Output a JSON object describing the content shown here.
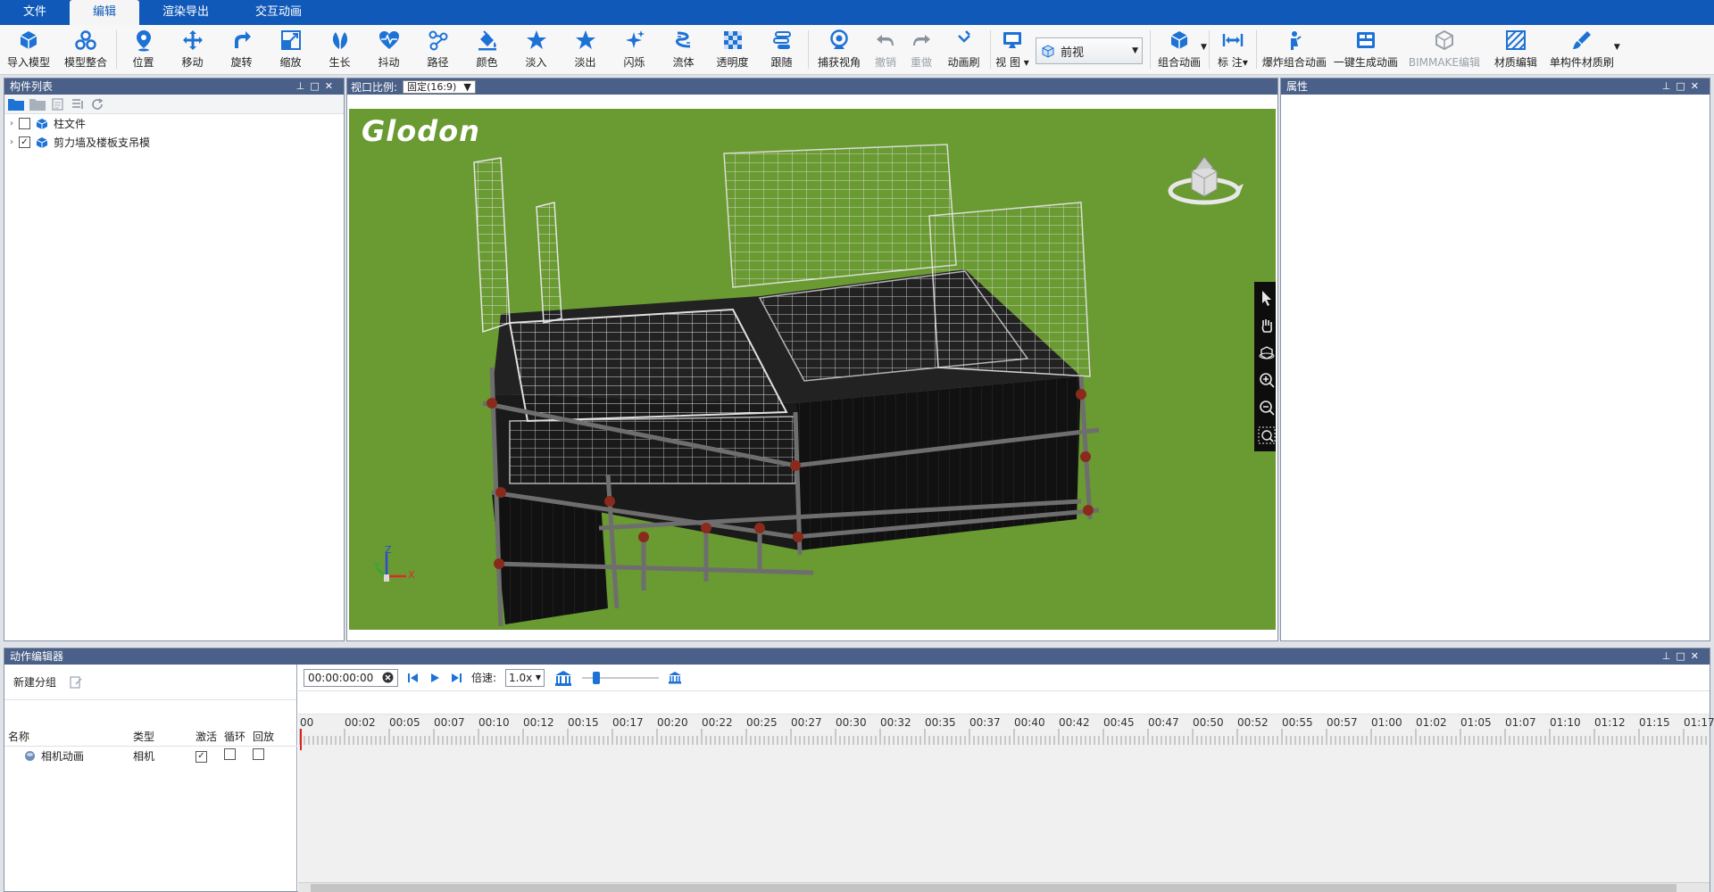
{
  "menu": {
    "tabs": [
      "文件",
      "编辑",
      "渲染导出",
      "交互动画"
    ],
    "active_index": 1
  },
  "ribbon": {
    "buttons": [
      {
        "label": "导入模型",
        "icon": "import-model-icon"
      },
      {
        "label": "模型整合",
        "icon": "model-integrate-icon"
      },
      {
        "label": "位置",
        "icon": "location-pin-icon"
      },
      {
        "label": "移动",
        "icon": "move-arrows-icon"
      },
      {
        "label": "旋转",
        "icon": "rotate-icon"
      },
      {
        "label": "缩放",
        "icon": "scale-icon"
      },
      {
        "label": "生长",
        "icon": "leaf-grow-icon"
      },
      {
        "label": "抖动",
        "icon": "heartbeat-icon"
      },
      {
        "label": "路径",
        "icon": "path-icon"
      },
      {
        "label": "颜色",
        "icon": "paint-bucket-icon"
      },
      {
        "label": "淡入",
        "icon": "star-fade-in-icon"
      },
      {
        "label": "淡出",
        "icon": "star-fade-out-icon"
      },
      {
        "label": "闪烁",
        "icon": "sparkle-icon"
      },
      {
        "label": "流体",
        "icon": "fluid-icon"
      },
      {
        "label": "透明度",
        "icon": "checker-transparency-icon"
      },
      {
        "label": "跟随",
        "icon": "follow-icon"
      },
      {
        "label": "捕获视角",
        "icon": "webcam-icon"
      },
      {
        "label": "撤销",
        "icon": "undo-icon"
      },
      {
        "label": "重做",
        "icon": "redo-icon"
      },
      {
        "label": "动画刷",
        "icon": "animation-brush-icon"
      }
    ],
    "view_button": "视 图",
    "view_select": "前视",
    "buttons_right": [
      {
        "label": "组合动画",
        "icon": "combo-animation-icon"
      },
      {
        "label": "标 注",
        "icon": "dimension-icon"
      },
      {
        "label": "爆炸组合动画",
        "icon": "explode-animation-icon"
      },
      {
        "label": "一键生成动画",
        "icon": "auto-generate-icon"
      },
      {
        "label": "BIMMAKE编辑",
        "icon": "bimmake-icon"
      },
      {
        "label": "材质编辑",
        "icon": "material-edit-icon"
      },
      {
        "label": "单构件材质刷",
        "icon": "material-brush-icon"
      }
    ]
  },
  "component_panel": {
    "title": "构件列表",
    "items": [
      {
        "label": "柱文件",
        "checked": false
      },
      {
        "label": "剪力墙及楼板支吊模",
        "checked": true
      }
    ]
  },
  "viewport_panel": {
    "ratio_label": "视口比例:",
    "ratio_value": "固定(16:9)",
    "logo": "Glodon"
  },
  "properties_panel": {
    "title": "属性"
  },
  "action_editor": {
    "title": "动作编辑器",
    "new_group": "新建分组",
    "columns": [
      "名称",
      "类型",
      "激活",
      "循环",
      "回放"
    ],
    "rows": [
      {
        "name": "相机动画",
        "type": "相机",
        "active": true,
        "loop": false,
        "playback": false
      }
    ],
    "time_value": "00:00:00:00",
    "speed_label": "倍速:",
    "speed_value": "1.0x",
    "ticks": [
      "00",
      "00:02",
      "00:05",
      "00:07",
      "00:10",
      "00:12",
      "00:15",
      "00:17",
      "00:20",
      "00:22",
      "00:25",
      "00:27",
      "00:30",
      "00:32",
      "00:35",
      "00:37",
      "00:40",
      "00:42",
      "00:45",
      "00:47",
      "00:50",
      "00:52",
      "00:55",
      "00:57",
      "01:00",
      "01:02",
      "01:05",
      "01:07",
      "01:10",
      "01:12",
      "01:15",
      "01:17"
    ]
  },
  "axes": {
    "x": "X",
    "y": "Y",
    "z": "Z"
  },
  "colors": {
    "menu_bar": "#1159b8",
    "panel_title": "#4a6088",
    "viewport_bg": "#6a9a32",
    "accent": "#1d72d6"
  }
}
